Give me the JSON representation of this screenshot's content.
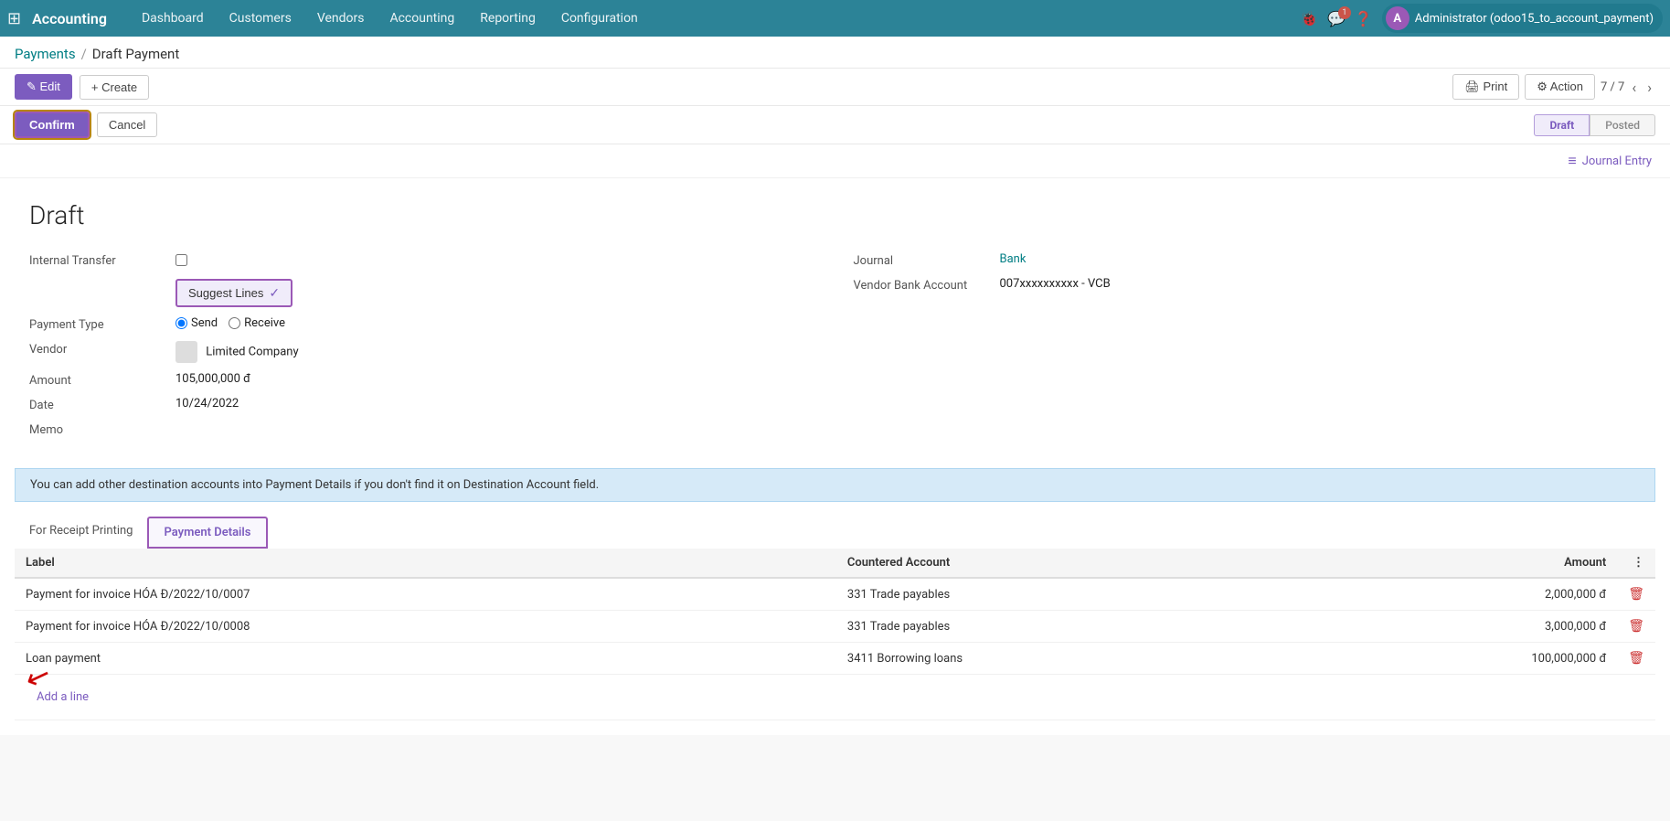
{
  "app": {
    "grid_icon": "⊞",
    "name": "Accounting"
  },
  "nav": {
    "items": [
      {
        "label": "Dashboard",
        "href": "#"
      },
      {
        "label": "Customers",
        "href": "#"
      },
      {
        "label": "Vendors",
        "href": "#"
      },
      {
        "label": "Accounting",
        "href": "#"
      },
      {
        "label": "Reporting",
        "href": "#"
      },
      {
        "label": "Configuration",
        "href": "#"
      }
    ]
  },
  "topright": {
    "bug_icon": "🐞",
    "chat_icon": "💬",
    "chat_badge": "1",
    "help_icon": "?",
    "user_initial": "A",
    "user_name": "Administrator (odoo15_to_account_payment)"
  },
  "breadcrumb": {
    "parent": "Payments",
    "separator": "/",
    "current": "Draft Payment"
  },
  "toolbar": {
    "edit_label": "✎ Edit",
    "create_label": "+ Create",
    "print_label": "🖨 Print",
    "action_label": "⚙ Action",
    "record_count": "7 / 7"
  },
  "action_bar": {
    "confirm_label": "Confirm",
    "cancel_label": "Cancel",
    "status_draft": "Draft",
    "status_posted": "Posted"
  },
  "journal_entry": {
    "icon": "≡",
    "label": "Journal Entry"
  },
  "form": {
    "title": "Draft",
    "fields": {
      "internal_transfer_label": "Internal Transfer",
      "suggest_lines_label": "Suggest Lines",
      "suggest_check": "✓",
      "payment_type_label": "Payment Type",
      "send_label": "Send",
      "receive_label": "Receive",
      "vendor_label": "Vendor",
      "vendor_value": "Limited Company",
      "amount_label": "Amount",
      "amount_value": "105,000,000 đ",
      "date_label": "Date",
      "date_value": "10/24/2022",
      "memo_label": "Memo",
      "memo_value": "",
      "journal_label": "Journal",
      "journal_value": "Bank",
      "vendor_bank_label": "Vendor Bank Account",
      "vendor_bank_value": "007xxxxxxxxxx - VCB"
    }
  },
  "info_banner": {
    "text": "You can add other destination accounts into Payment Details if you don't find it on Destination Account field."
  },
  "tabs": [
    {
      "label": "For Receipt Printing",
      "id": "receipt"
    },
    {
      "label": "Payment Details",
      "id": "details",
      "active": true
    }
  ],
  "table": {
    "columns": [
      {
        "label": "Label"
      },
      {
        "label": "Countered Account"
      },
      {
        "label": "Amount",
        "align": "right"
      },
      {
        "label": "",
        "align": "right"
      }
    ],
    "rows": [
      {
        "label": "Payment for invoice HÓA Đ/2022/10/0007",
        "countered_account": "331 Trade payables",
        "amount": "2,000,000 đ"
      },
      {
        "label": "Payment for invoice HÓA Đ/2022/10/0008",
        "countered_account": "331 Trade payables",
        "amount": "3,000,000 đ"
      },
      {
        "label": "Loan payment",
        "countered_account": "3411 Borrowing loans",
        "amount": "100,000,000 đ"
      }
    ],
    "add_line": "Add a line"
  }
}
